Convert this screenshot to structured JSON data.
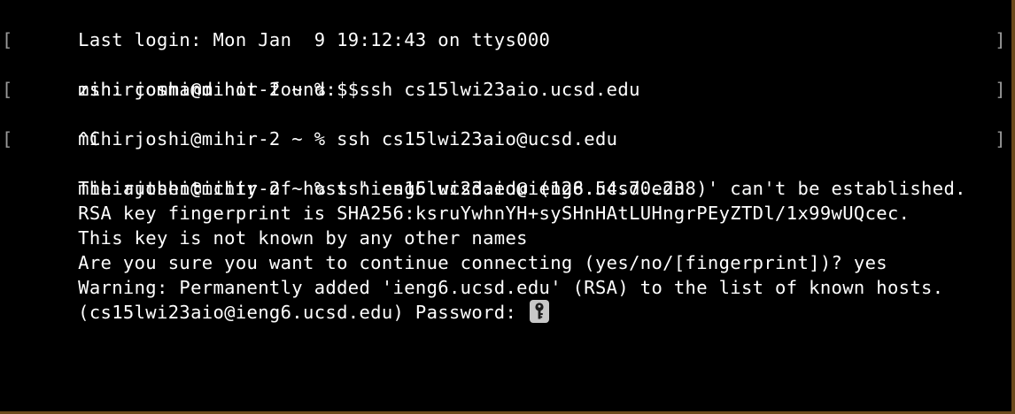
{
  "terminal": {
    "lines": [
      {
        "text": "Last login: Mon Jan  9 19:12:43 on ttys000",
        "prompt": false
      },
      {
        "text": "mihirjoshi@mihir-2 ~ % $ ssh cs15lwi23aio.ucsd.edu",
        "prompt": true
      },
      {
        "text": "zsh: command not found: $",
        "prompt": false
      },
      {
        "text": "mihirjoshi@mihir-2 ~ % ssh cs15lwi23aio@ucsd.edu",
        "prompt": true
      },
      {
        "text": "^C",
        "prompt": false
      },
      {
        "text": "mihirjoshi@mihir-2 ~ % ssh cs15lwi23aio@ieng6.ucsd.edu",
        "prompt": true
      },
      {
        "text": "The authenticity of host 'ieng6.ucsd.edu (128.54.70.238)' can't be established.",
        "prompt": false
      },
      {
        "text": "RSA key fingerprint is SHA256:ksruYwhnYH+sySHnHAtLUHngrPEyZTDl/1x99wUQcec.",
        "prompt": false
      },
      {
        "text": "This key is not known by any other names",
        "prompt": false
      },
      {
        "text": "Are you sure you want to continue connecting (yes/no/[fingerprint])? yes",
        "prompt": false
      },
      {
        "text": "Warning: Permanently added 'ieng6.ucsd.edu' (RSA) to the list of known hosts.",
        "prompt": false
      }
    ],
    "password_prompt": "(cs15lwi23aio@ieng6.ucsd.edu) Password: ",
    "prompt_bracket_left": "[",
    "prompt_bracket_right": "]",
    "cursor_icon": "key-icon",
    "colors": {
      "background": "#000000",
      "foreground": "#ffffff",
      "bracket": "#9a9a9a",
      "window_edge": "#6b4a1c"
    }
  }
}
